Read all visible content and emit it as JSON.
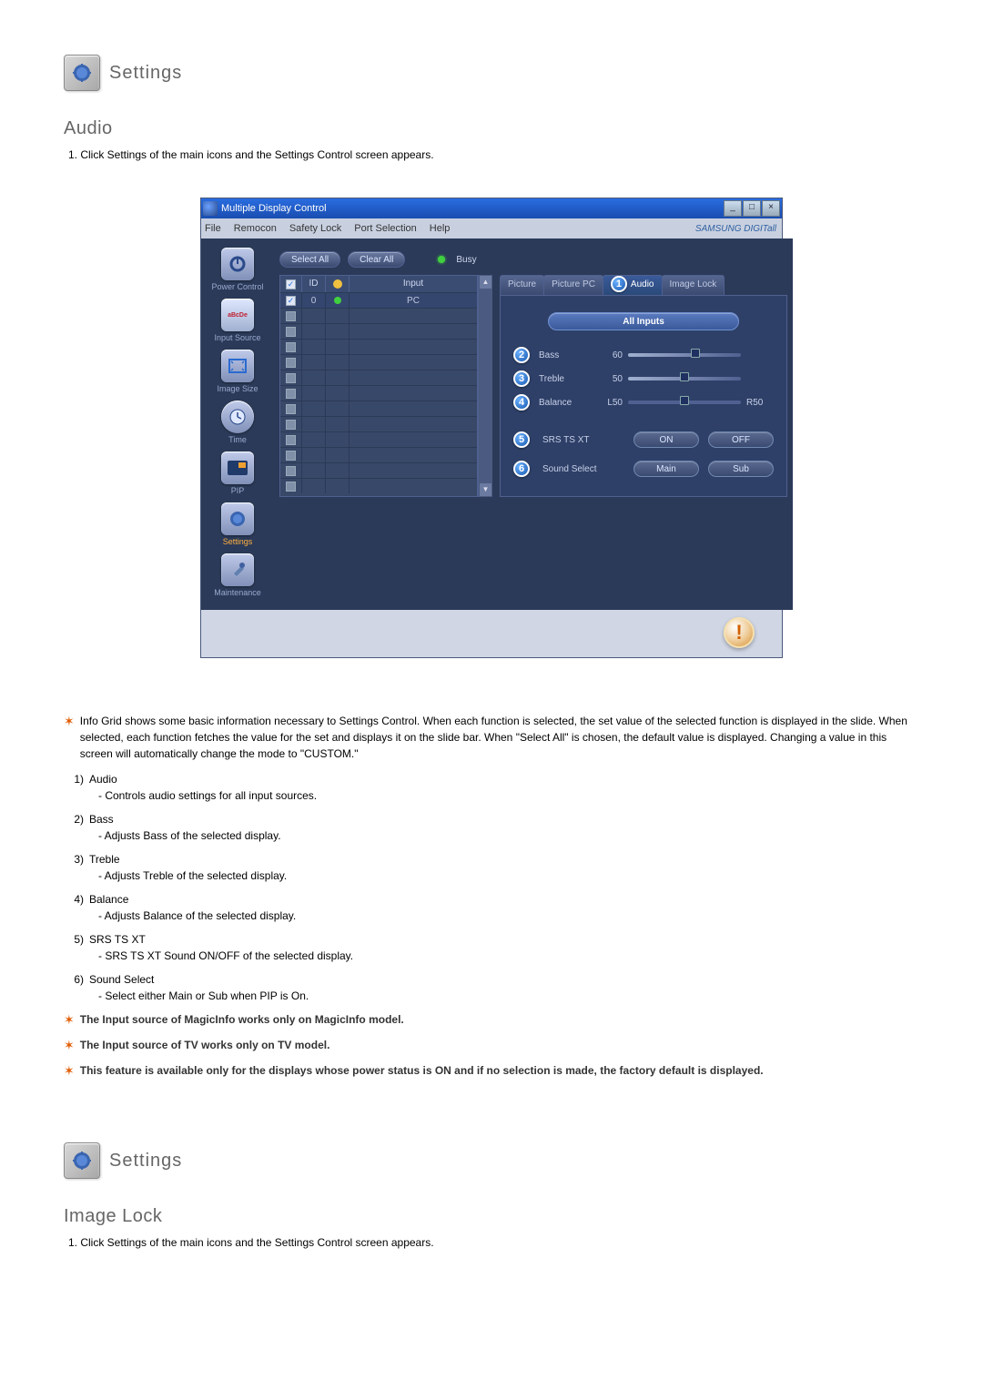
{
  "section1": {
    "header": "Settings",
    "title": "Audio",
    "step": "1. Click Settings of the main icons and the Settings Control screen appears."
  },
  "section2": {
    "header": "Settings",
    "title": "Image Lock",
    "step": "1. Click Settings of the main icons and the Settings Control screen appears."
  },
  "app": {
    "title": "Multiple Display Control",
    "menus": [
      "File",
      "Remocon",
      "Safety Lock",
      "Port Selection",
      "Help"
    ],
    "brand": "SAMSUNG DIGITall",
    "select_all": "Select All",
    "clear_all": "Clear All",
    "busy": "Busy",
    "sidebar": [
      {
        "label": "Power Control"
      },
      {
        "label": "Input Source"
      },
      {
        "label": "Image Size"
      },
      {
        "label": "Time"
      },
      {
        "label": "PIP"
      },
      {
        "label": "Settings"
      },
      {
        "label": "Maintenance"
      }
    ],
    "grid": {
      "headers": {
        "id": "ID",
        "input": "Input"
      },
      "row0": {
        "id": "0",
        "input": "PC"
      }
    },
    "tabs": [
      "Picture",
      "Picture PC",
      "Audio",
      "Image Lock"
    ],
    "audio": {
      "all_inputs": "All Inputs",
      "bass": {
        "label": "Bass",
        "value": "60"
      },
      "treble": {
        "label": "Treble",
        "value": "50"
      },
      "balance": {
        "label": "Balance",
        "left": "L50",
        "right": "R50"
      },
      "srs": {
        "label": "SRS TS XT",
        "on": "ON",
        "off": "OFF"
      },
      "sound_select": {
        "label": "Sound Select",
        "main": "Main",
        "sub": "Sub"
      }
    }
  },
  "notes": {
    "star1": "Info Grid shows some basic information necessary to Settings Control. When each function is selected, the set value of the selected function is displayed in the slide. When selected, each function fetches the value for the set and displays it on the slide bar. When \"Select All\" is chosen, the default value is displayed. Changing a value in this screen will automatically change the mode to \"CUSTOM.\"",
    "items": [
      {
        "num": "1)",
        "title": "Audio",
        "desc": "- Controls audio settings for all input sources."
      },
      {
        "num": "2)",
        "title": "Bass",
        "desc": "- Adjusts Bass of the selected display."
      },
      {
        "num": "3)",
        "title": "Treble",
        "desc": "- Adjusts Treble of the selected display."
      },
      {
        "num": "4)",
        "title": "Balance",
        "desc": "- Adjusts Balance of the selected display."
      },
      {
        "num": "5)",
        "title": "SRS TS XT",
        "desc": "- SRS TS XT Sound ON/OFF of the selected display."
      },
      {
        "num": "6)",
        "title": "Sound Select",
        "desc": "- Select either Main or Sub when PIP is On."
      }
    ],
    "star2": "The Input source of MagicInfo works only on MagicInfo model.",
    "star3": "The Input source of TV works only on TV model.",
    "star4": "This feature is available only for the displays whose power status is ON and if no selection is made, the factory default is displayed."
  }
}
